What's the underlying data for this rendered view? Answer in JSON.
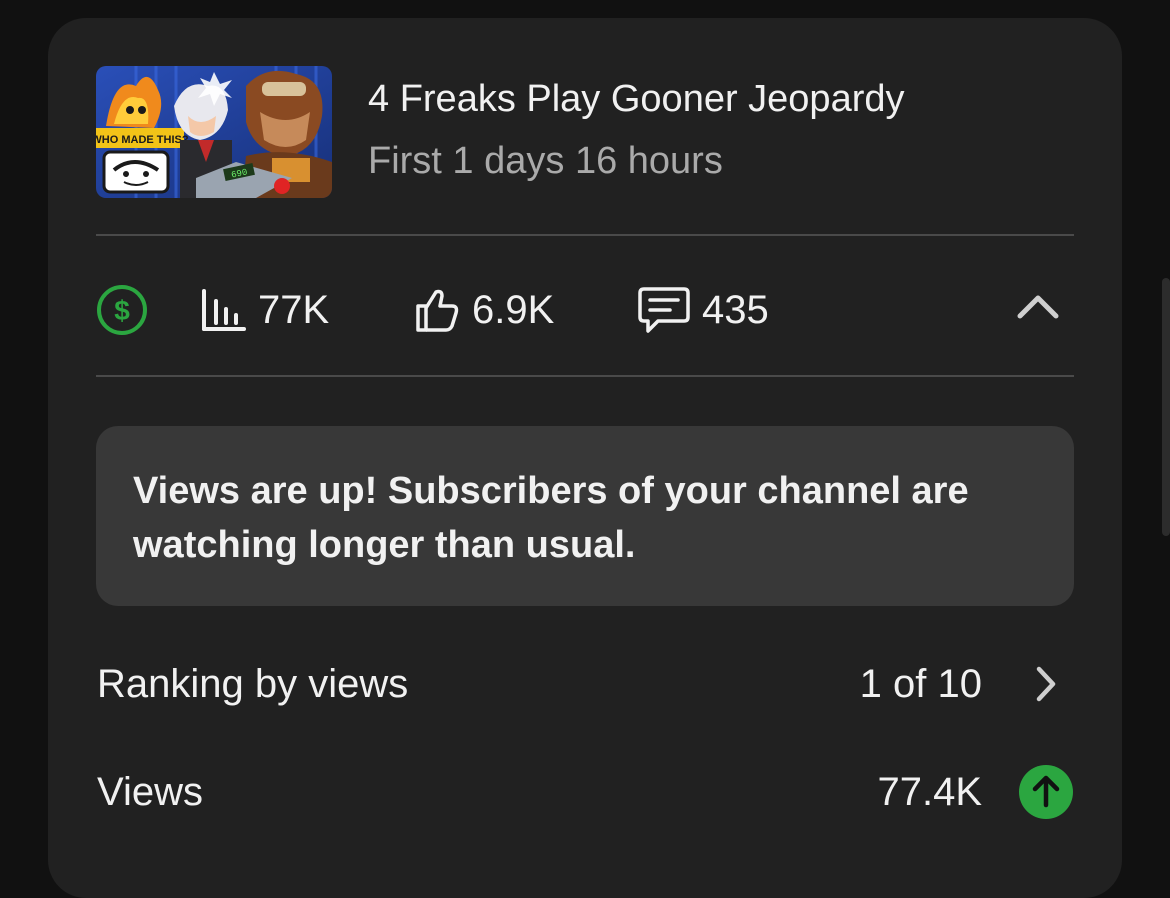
{
  "video": {
    "title": "4 Freaks Play Gooner Jeopardy",
    "period": "First 1 days 16 hours",
    "thumbnail": {
      "banner_text": "WHO MADE THIS?",
      "counter_text": "690"
    }
  },
  "stats": {
    "monetization_icon": "dollar-circle-icon",
    "views": "77K",
    "likes": "6.9K",
    "comments": "435",
    "collapse_icon": "chevron-up-icon"
  },
  "insight": {
    "message": "Views are up! Subscribers of your channel are watching longer than usual."
  },
  "rows": {
    "ranking": {
      "label": "Ranking by views",
      "value": "1 of 10",
      "icon": "chevron-right-icon"
    },
    "views": {
      "label": "Views",
      "value": "77.4K",
      "icon": "arrow-up-circle-icon"
    }
  },
  "colors": {
    "card_bg": "#212121",
    "accent_green": "#2ba640",
    "insight_bg": "#383838",
    "secondary_text": "#aaaaaa"
  }
}
